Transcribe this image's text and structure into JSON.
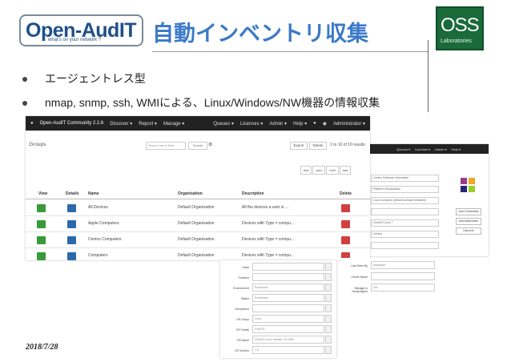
{
  "header": {
    "logo_word": "Open-AudIT",
    "logo_tagline": "what's on your network ?",
    "title": "自動インベントリ収集",
    "oss_logo_big": "OSS",
    "oss_logo_small": "Laboratories"
  },
  "bullets": [
    "エージェントレス型",
    "nmap, snmp, ssh, WMIによる、Linux/Windows/NW機器の情報収集"
  ],
  "app": {
    "brand": "Open-AudIT Community 2.2.6",
    "nav_left": [
      "Discover ▾",
      "Report ▾",
      "Manage ▾"
    ],
    "nav_right": [
      "Queues ▾",
      "Licenses ▾",
      "Admin ▾",
      "Help ▾",
      "Administrator ▾"
    ],
    "section_label": "Groups",
    "search_placeholder": "Search name field",
    "search_button": "Submit",
    "export_button": "Export",
    "delete_button": "Delete",
    "result_count": "1 to 10 of 10 results",
    "pager": [
      "first",
      "prev",
      "next",
      "last"
    ],
    "columns": [
      "View",
      "Details",
      "Name",
      "Organisation",
      "Description",
      "Delete"
    ],
    "rows": [
      {
        "name": "All Devices",
        "org": "Default Organisation",
        "desc": "All the devices a user is ..."
      },
      {
        "name": "Apple Computers",
        "org": "Default Organisation",
        "desc": "Devices with Type = compu..."
      },
      {
        "name": "Centos Computers",
        "org": "Default Organisation",
        "desc": "Devices with Type = compu..."
      },
      {
        "name": "Computers",
        "org": "Default Organisation",
        "desc": "Devices with Type = compu..."
      }
    ]
  },
  "detail_panel": {
    "nav": [
      "Queues ▾",
      "Licenses ▾",
      "Admin ▾",
      "Help ▾"
    ],
    "fields": [
      "Centos Software Information",
      "Platform Virtualization",
      "Linux computer (default software installed)",
      "",
      "CentOS Linux 7",
      "Centos",
      "",
      "",
      "CentOS 7 (Core)"
    ],
    "buttons": [
      "Add Credentials",
      "Add Attachment",
      "Discover"
    ]
  },
  "form_panel": {
    "rows": [
      {
        "label": "Class",
        "value": ""
      },
      {
        "label": "Function",
        "value": ""
      },
      {
        "label": "Environment",
        "value": "Production"
      },
      {
        "label": "Status",
        "value": "Production"
      },
      {
        "label": "Description",
        "value": ""
      },
      {
        "label": "OS Group",
        "value": "Linux"
      },
      {
        "label": "OS Family",
        "value": "CentOS"
      },
      {
        "label": "OS Name",
        "value": "CentOS Linux release 7.5.1804"
      },
      {
        "label": "OS Version",
        "value": "7.5"
      }
    ]
  },
  "side_form": {
    "rows": [
      {
        "label": "Last Seen By",
        "value": "nmap/ssh"
      },
      {
        "label": "Owner Name",
        "value": ""
      },
      {
        "label": "Manage in Nmap/Agent",
        "value": "Yes"
      }
    ]
  },
  "footer": {
    "date": "2018/7/28"
  }
}
